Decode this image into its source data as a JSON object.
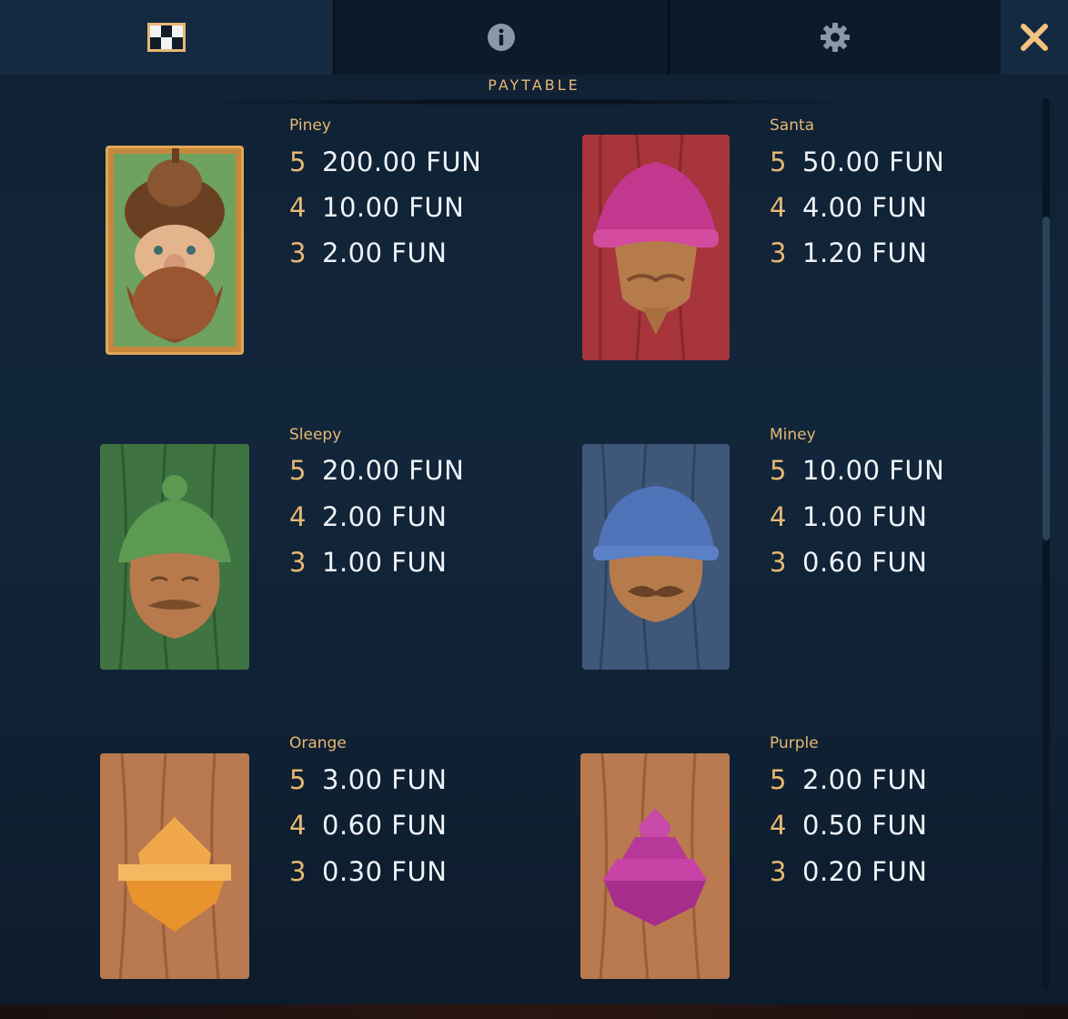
{
  "tabs": [
    {
      "name": "paytable",
      "icon": "checkered-grid-icon",
      "active": true
    },
    {
      "name": "info",
      "icon": "info-icon",
      "active": false
    },
    {
      "name": "settings",
      "icon": "gear-icon",
      "active": false
    }
  ],
  "close_icon": "close-icon",
  "section_title": "PAYTABLE",
  "symbols": [
    {
      "name": "Piney",
      "pays": [
        {
          "count": "5",
          "value": "200.00 FUN"
        },
        {
          "count": "4",
          "value": "10.00 FUN"
        },
        {
          "count": "3",
          "value": "2.00 FUN"
        }
      ]
    },
    {
      "name": "Santa",
      "pays": [
        {
          "count": "5",
          "value": "50.00 FUN"
        },
        {
          "count": "4",
          "value": "4.00 FUN"
        },
        {
          "count": "3",
          "value": "1.20 FUN"
        }
      ]
    },
    {
      "name": "Sleepy",
      "pays": [
        {
          "count": "5",
          "value": "20.00 FUN"
        },
        {
          "count": "4",
          "value": "2.00 FUN"
        },
        {
          "count": "3",
          "value": "1.00 FUN"
        }
      ]
    },
    {
      "name": "Miney",
      "pays": [
        {
          "count": "5",
          "value": "10.00 FUN"
        },
        {
          "count": "4",
          "value": "1.00 FUN"
        },
        {
          "count": "3",
          "value": "0.60 FUN"
        }
      ]
    },
    {
      "name": "Orange",
      "pays": [
        {
          "count": "5",
          "value": "3.00 FUN"
        },
        {
          "count": "4",
          "value": "0.60 FUN"
        },
        {
          "count": "3",
          "value": "0.30 FUN"
        }
      ]
    },
    {
      "name": "Purple",
      "pays": [
        {
          "count": "5",
          "value": "2.00 FUN"
        },
        {
          "count": "4",
          "value": "0.50 FUN"
        },
        {
          "count": "3",
          "value": "0.20 FUN"
        }
      ]
    }
  ],
  "colors": {
    "accent": "#e7b873",
    "background": "#12263b",
    "text": "#eef2f7"
  }
}
